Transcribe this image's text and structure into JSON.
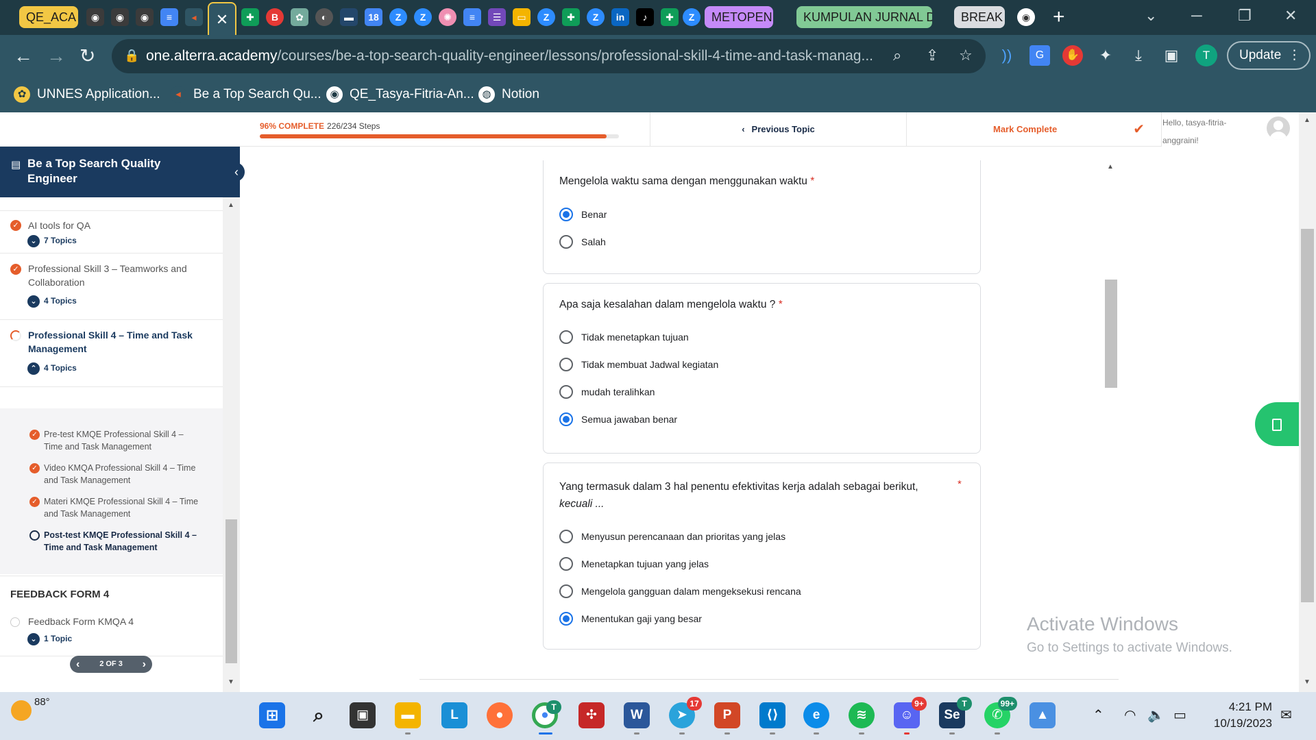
{
  "browser": {
    "tab_groups": [
      {
        "label": "QE_ACA",
        "color": "#f2c744"
      },
      {
        "label": "METOPEN",
        "color": "#c58af9"
      },
      {
        "label": "KUMPULAN JURNAL D",
        "color": "#81c995"
      },
      {
        "label": "BREAK",
        "color": "#dadce0"
      }
    ],
    "url_host": "one.alterra.academy",
    "url_path": "/courses/be-a-top-search-quality-engineer/lessons/professional-skill-4-time-and-task-manag...",
    "profile_initial": "T",
    "update_label": "Update",
    "bookmarks": [
      {
        "label": "UNNES Application...",
        "icon": "unnes-icon"
      },
      {
        "label": "Be a Top Search Qu...",
        "icon": "alterra-icon"
      },
      {
        "label": "QE_Tasya-Fitria-An...",
        "icon": "github-icon"
      },
      {
        "label": "Notion",
        "icon": "globe-icon"
      }
    ]
  },
  "topbar": {
    "complete_percent_label": "96% COMPLETE",
    "steps_label": "226/234 Steps",
    "progress_fraction": 0.966,
    "previous_topic": "Previous Topic",
    "mark_complete": "Mark Complete",
    "greeting_line1": "Hello, tasya-fitria-",
    "greeting_line2": "anggraini!"
  },
  "sidebar": {
    "course_title_line1": "Be a Top Search Quality",
    "course_title_line2": "Engineer",
    "sections": [
      {
        "title": "AI tools for QA",
        "topics": "7 Topics"
      },
      {
        "title": "Professional Skill 3 – Teamworks and Collaboration",
        "topics": "4 Topics"
      },
      {
        "title": "Professional Skill 4 – Time and Task Management",
        "topics": "4 Topics"
      }
    ],
    "lessons": [
      {
        "title": "Pre-test KMQE Professional Skill 4 – Time and Task Management",
        "done": true
      },
      {
        "title": "Video KMQA Professional Skill 4 – Time and Task Management",
        "done": true
      },
      {
        "title": "Materi KMQE Professional Skill 4 – Time and Task Management",
        "done": true
      },
      {
        "title": "Post-test KMQE Professional Skill 4 – Time and Task Management",
        "done": false
      }
    ],
    "feedback_heading": "FEEDBACK FORM 4",
    "feedback_item": "Feedback Form KMQA 4",
    "feedback_topics": "1 Topic",
    "pager": "2 OF 3"
  },
  "quiz": {
    "questions": [
      {
        "text": "Mengelola waktu sama dengan menggunakan waktu",
        "required": "*",
        "options": [
          "Benar",
          "Salah"
        ],
        "selected": 0
      },
      {
        "text": "Apa saja kesalahan dalam mengelola waktu ?",
        "required": "*",
        "options": [
          "Tidak menetapkan tujuan",
          "Tidak membuat Jadwal kegiatan",
          "mudah teralihkan",
          "Semua jawaban benar"
        ],
        "selected": 3
      },
      {
        "text": "Yang termasuk dalam 3 hal penentu efektivitas kerja adalah sebagai berikut,",
        "text_italic": "kecuali ...",
        "required": "*",
        "options": [
          "Menyusun perencanaan dan prioritas yang jelas",
          "Menetapkan tujuan yang jelas",
          "Mengelola gangguan dalam mengeksekusi rencana",
          "Menentukan gaji yang besar"
        ],
        "selected": 3
      }
    ]
  },
  "watermark": {
    "line1": "Activate Windows",
    "line2": "Go to Settings to activate Windows."
  },
  "taskbar": {
    "weather_temp": "88°",
    "time": "4:21 PM",
    "date": "10/19/2023",
    "badges": {
      "chrome": "T",
      "telegram": "17",
      "discord": "9+",
      "selenium": "T",
      "whatsapp": "99+"
    }
  }
}
